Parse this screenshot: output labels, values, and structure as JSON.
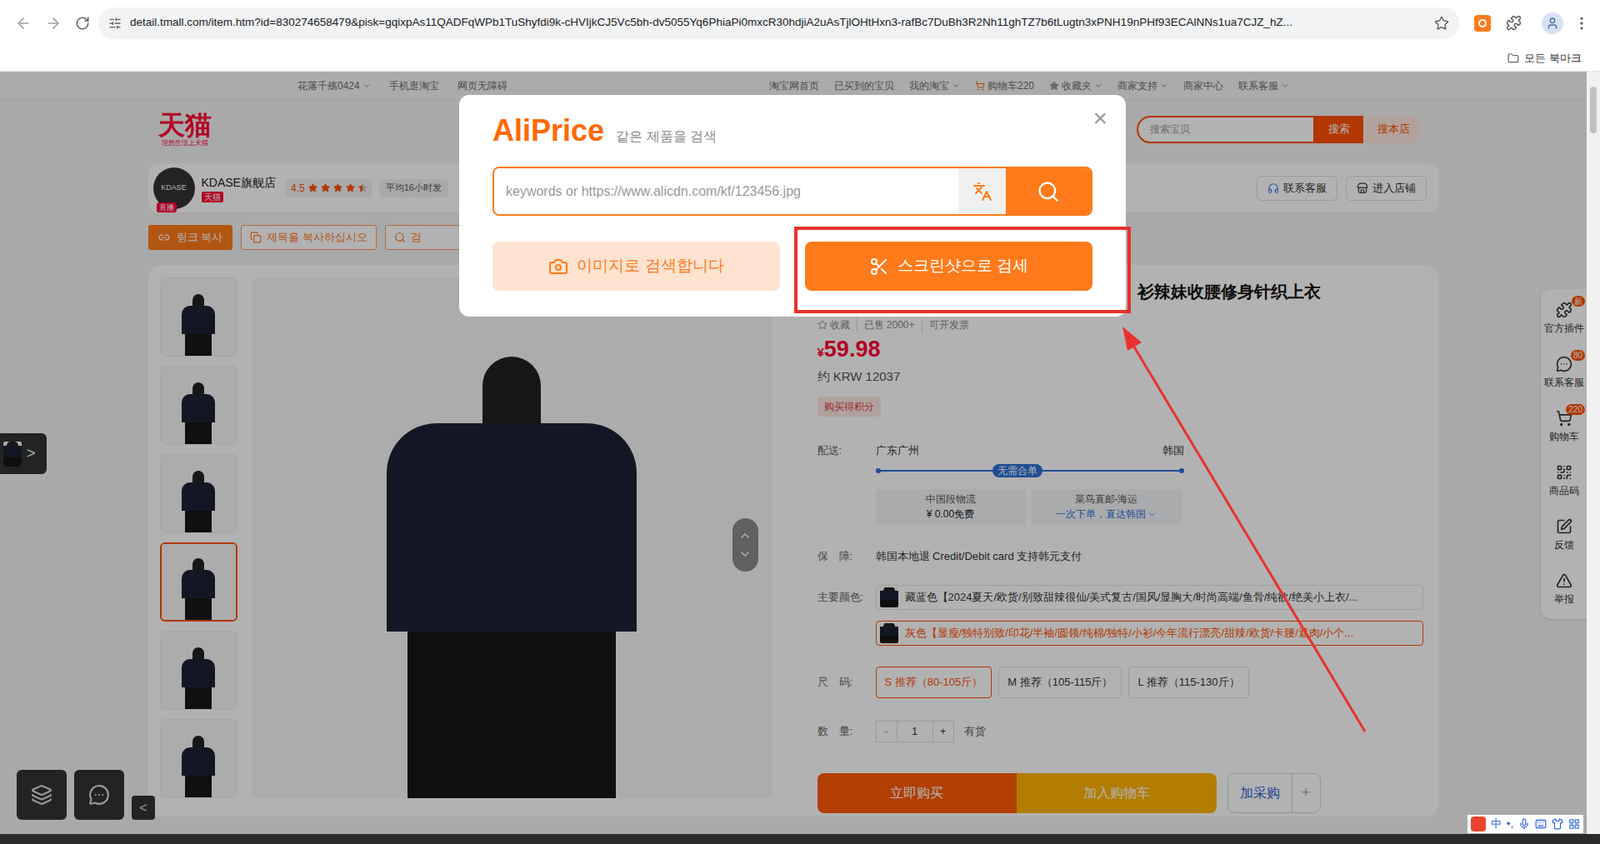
{
  "browser": {
    "url": "detail.tmall.com/item.htm?id=830274658479&pisk=gqixpAs11QADFqWPb1TuShyfdi9k-cHVIjkCJ5Vc5bh-dv5055Yq6PhiaPi0mxcR30hdjiA2uAsTjlOHtHxn3-rafBc7DuBh3R2Nh11ghTZ7b6tLugtn3xPNH19nPHf93ECAlNNs1ua7CJZ_hZ...",
    "bookmarks": "모든 북마크"
  },
  "top_nav": {
    "left": [
      {
        "label": "花落千殇0424",
        "kind": "text",
        "dropdown": true
      },
      {
        "label": "手机逛淘宝",
        "kind": "text",
        "dropdown": false
      },
      {
        "label": "网页无障碍",
        "kind": "text",
        "dropdown": false
      }
    ],
    "right": [
      {
        "label": "淘宝网首页",
        "kind": "text",
        "dropdown": false
      },
      {
        "label": "已买到的宝贝",
        "kind": "text",
        "dropdown": false
      },
      {
        "label": "我的淘宝",
        "kind": "text",
        "dropdown": true
      },
      {
        "label": "购物车220",
        "kind": "cart",
        "dropdown": false
      },
      {
        "label": "收藏夹",
        "kind": "favorite",
        "dropdown": true
      },
      {
        "label": "商家支持",
        "kind": "text",
        "dropdown": true
      },
      {
        "label": "商家中心",
        "kind": "text",
        "dropdown": false
      },
      {
        "label": "联系客服",
        "kind": "text",
        "dropdown": true
      }
    ]
  },
  "header": {
    "logo": "天猫",
    "logo_sub": "理想生活上天猫",
    "search_placeholder": "搜索宝贝",
    "search_button": "搜索",
    "store_search_button": "搜本店"
  },
  "store": {
    "avatar_text": "KDASE",
    "live_badge": "直播",
    "name": "KDASE旗舰店",
    "tmall_badge": "天猫",
    "rating": "4.5",
    "stars": 4.5,
    "shipping": "平均16小时发",
    "contact": "联系客服",
    "enter": "进入店铺"
  },
  "tools": [
    {
      "label": "링크 복사",
      "primary": true
    },
    {
      "label": "제목을 복사하십시오",
      "primary": false
    },
    {
      "label": "검",
      "primary": false
    }
  ],
  "gallery": {
    "thumbnails": [
      {
        "selected": false
      },
      {
        "selected": false
      },
      {
        "selected": false
      },
      {
        "selected": true
      },
      {
        "selected": false
      },
      {
        "selected": false
      }
    ]
  },
  "product": {
    "title": "衫辣妹收腰修身针织上衣",
    "meta": [
      "收藏",
      "已售 2000+",
      "可开发票"
    ],
    "price_symbol": "¥",
    "price": "59.98",
    "approx": "约 KRW 12037",
    "points_badge": "购买得积分",
    "delivery": {
      "label": "配送:",
      "from": "广东广州",
      "to": "韩国",
      "badge": "无需合单",
      "options": [
        {
          "title": "中国段物流",
          "detail": "¥ 0.00免费",
          "link": false
        },
        {
          "title": "菜鸟直邮-海运",
          "detail": "一次下单，直达韩国",
          "link": true
        }
      ]
    },
    "guarantee": {
      "label": "保　障:",
      "text": "韩国本地退 Credit/Debit card 支持韩元支付"
    },
    "colors": {
      "label": "主要颜色:",
      "options": [
        {
          "label": "藏蓝色【2024夏天/欧货/别致甜辣很仙/美式复古/国风/显胸大/时尚高端/鱼骨/纯欲/绝美小上衣/...",
          "selected": false
        },
        {
          "label": "灰色【显瘦/独特别致/印花/半袖/圆领/纯棉/独特/小衫/今年流行漂亮/甜辣/欧货/卡腰/遮肉/小个...",
          "selected": true
        }
      ]
    },
    "sizes": {
      "label": "尺　码:",
      "options": [
        {
          "label": "S 推荐（80-105斤）",
          "selected": true
        },
        {
          "label": "M 推荐（105-115斤）",
          "selected": false
        },
        {
          "label": "L 推荐（115-130斤）",
          "selected": false
        }
      ]
    },
    "quantity": {
      "label": "数　量:",
      "minus": "-",
      "value": "1",
      "plus": "+",
      "stock": "有货"
    },
    "actions": {
      "buy": "立即购买",
      "cart": "加入购物车",
      "purchase": "加采购",
      "add": "+"
    }
  },
  "side_toolbar": [
    {
      "label": "官方插件",
      "badge": "新"
    },
    {
      "label": "联系客服",
      "badge": "80"
    },
    {
      "label": "购物车",
      "badge": "220"
    },
    {
      "label": "商品码",
      "badge": ""
    },
    {
      "label": "反馈",
      "badge": ""
    },
    {
      "label": "举报",
      "badge": ""
    }
  ],
  "page_widgets": {
    "expand": ">",
    "collapse": "<"
  },
  "ime": [
    "中",
    "•,"
  ],
  "aliprice": {
    "logo": "AliPrice",
    "subtitle": "같은 제품을 검색",
    "close": "×",
    "placeholder": "keywords or https://www.alicdn.com/kf/123456.jpg",
    "buttons": [
      {
        "label": "이미지로 검색합니다",
        "primary": false,
        "highlighted": false
      },
      {
        "label": "스크린샷으로 검세",
        "primary": true,
        "highlighted": true
      }
    ]
  }
}
